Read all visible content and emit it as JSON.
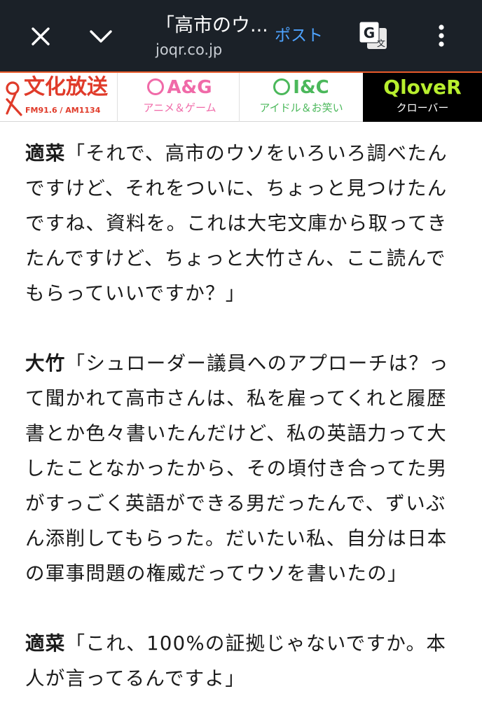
{
  "browser": {
    "title": "「高市のウ...",
    "url": "joqr.co.jp",
    "post_label": "ポスト",
    "icons": [
      "close-icon",
      "chevron-down-icon",
      "translate-icon",
      "more-vert-icon"
    ]
  },
  "banner": {
    "bunka": {
      "logo": "文化放送",
      "sub": "FM91.6 / AM1134",
      "color": "#e03b2a"
    },
    "ag": {
      "logo": "A&G",
      "sub": "アニメ＆ゲーム",
      "color": "#f06aa8"
    },
    "ic": {
      "logo": "I&C",
      "sub": "アイドル＆お笑い",
      "color": "#4bb85b"
    },
    "qlover": {
      "logo": "QloveR",
      "sub": "クローバー",
      "color": "#b8ef2e"
    }
  },
  "article": {
    "paragraphs": [
      {
        "speaker": "適菜",
        "text": "「それで、高市のウソをいろいろ調べたんですけど、それをついに、ちょっと見つけたんですね、資料を。これは大宅文庫から取ってきたんですけど、ちょっと大竹さん、ここ読んでもらっていいですか？」"
      },
      {
        "speaker": "大竹",
        "text": "「シュローダー議員へのアプローチは？って聞かれて高市さんは、私を雇ってくれと履歴書とか色々書いたんだけど、私の英語力って大したことなかったから、その頃付き合ってた男がすっごく英語ができる男だったんで、ずいぶん添削してもらった。だいたい私、自分は日本の軍事問題の権威だってウソを書いたの」"
      },
      {
        "speaker": "適菜",
        "text": "「これ、100%の証拠じゃないですか。本人が言ってるんですよ」"
      }
    ]
  }
}
